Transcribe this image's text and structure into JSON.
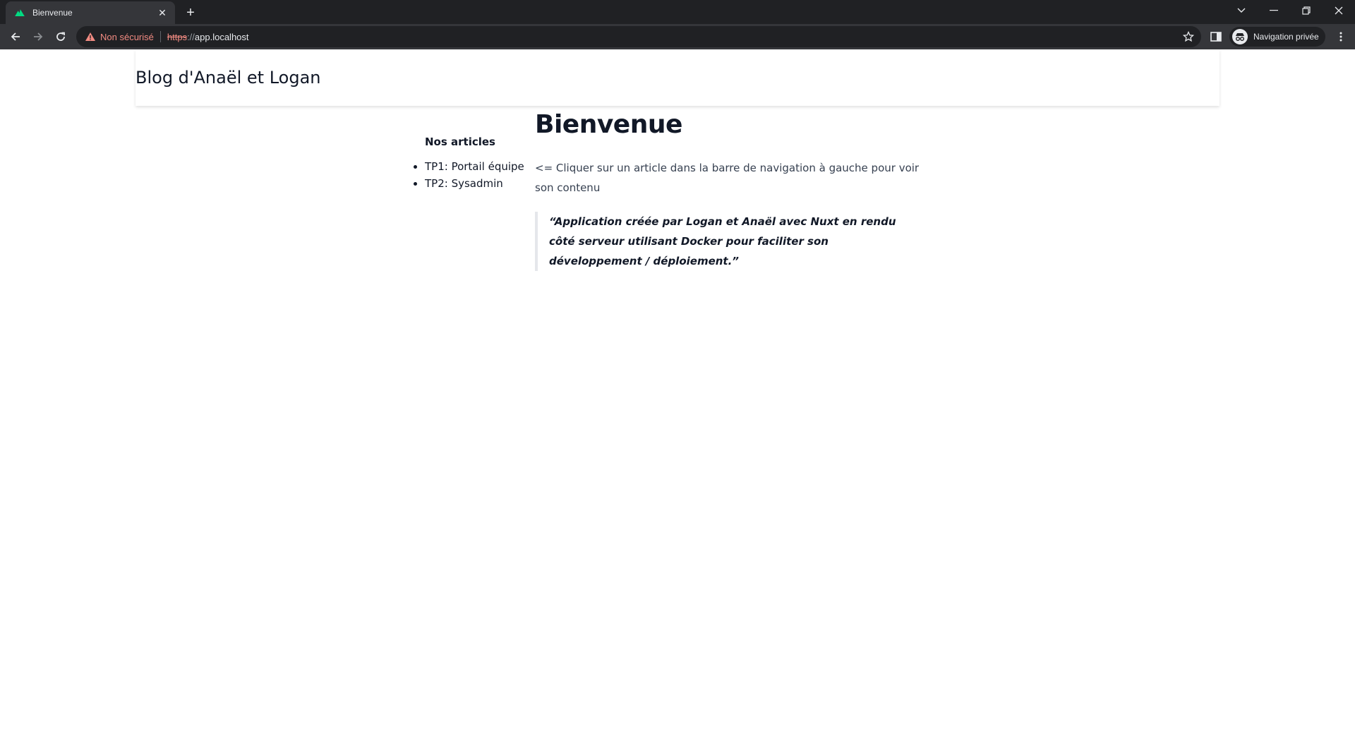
{
  "browser": {
    "tab": {
      "title": "Bienvenue"
    },
    "omnibox": {
      "security_label": "Non sécurisé",
      "url_scheme": "https",
      "url_separator": "://",
      "url_host": "app.localhost"
    },
    "profile": {
      "label": "Navigation privée"
    }
  },
  "site": {
    "title": "Blog d'Anaël et Logan"
  },
  "sidebar": {
    "heading": "Nos articles",
    "items": [
      {
        "label": "TP1: Portail équipe"
      },
      {
        "label": "TP2: Sysadmin"
      }
    ]
  },
  "main": {
    "heading": "Bienvenue",
    "intro": "<= Cliquer sur un article dans la barre de navigation à gauche pour voir son contenu",
    "quote": "“Application créée par Logan et Anaël avec Nuxt en rendu côté serveur utilisant Docker pour faciliter son développement / déploiement.”"
  },
  "colors": {
    "chrome_dark": "#202124",
    "chrome_toolbar": "#35363a",
    "warning": "#f28b82",
    "nuxt_green": "#00dc82",
    "text_dark": "#111827"
  }
}
